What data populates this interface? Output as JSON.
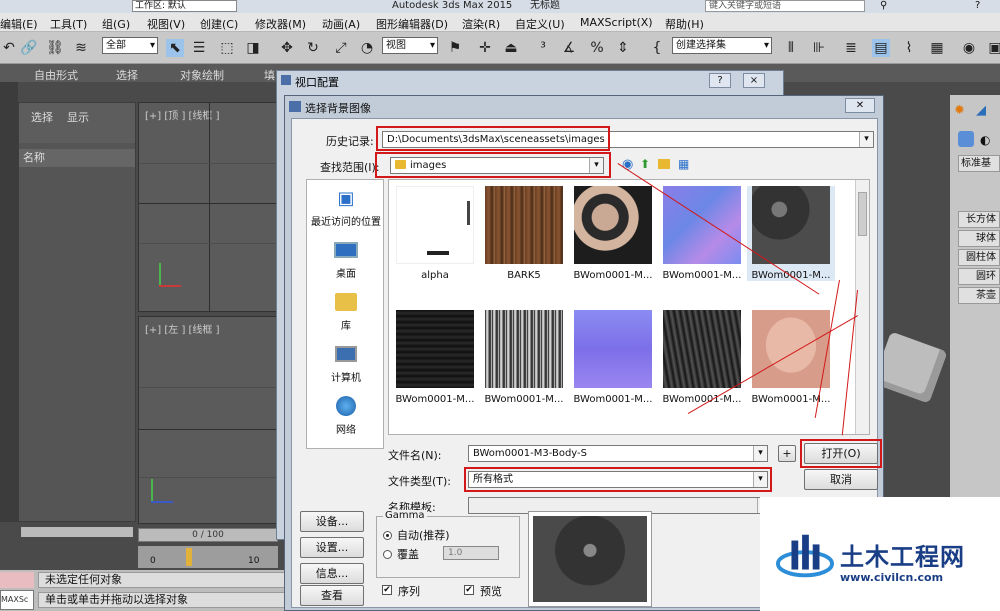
{
  "app": {
    "title": "Autodesk 3ds Max  2015",
    "doc_title": "无标题",
    "workspace": "工作区: 默认",
    "search_placeholder": "键入关键字或短语"
  },
  "menu": [
    "编辑(E)",
    "工具(T)",
    "组(G)",
    "视图(V)",
    "创建(C)",
    "修改器(M)",
    "动画(A)",
    "图形编辑器(D)",
    "渲染(R)",
    "自定义(U)",
    "MAXScript(X)",
    "帮助(H)"
  ],
  "toolbar": {
    "filter": "全部",
    "ref_coord": "视图",
    "named_sel": "创建选择集"
  },
  "ribbon_tabs": [
    "自由形式",
    "选择",
    "对象绘制",
    "填"
  ],
  "left_panel": {
    "tab_select": "选择",
    "tab_display": "显示",
    "name_header": "名称"
  },
  "viewports": {
    "top_label": "[+] [顶 ] [线框 ]",
    "left_label": "[+] [左 ] [线框 ]"
  },
  "right_panel": {
    "dropdown": "标准基本",
    "buttons": [
      "长方体",
      "球体",
      "圆柱体",
      "圆环",
      "茶壶"
    ]
  },
  "timeline": {
    "frame": "0 / 100",
    "tick": "10",
    "tick0": "0"
  },
  "status": {
    "line1": "未选定任何对象",
    "line2": "单击或单击并拖动以选择对象",
    "maxscript": "MAXSc"
  },
  "vpconfig": {
    "title": "视口配置",
    "help": "?",
    "close": "×"
  },
  "dialog": {
    "title": "选择背景图像",
    "close": "✕",
    "history_label": "历史记录:",
    "history_value": "D:\\Documents\\3dsMax\\sceneassets\\images",
    "lookin_label": "查找范围(I):",
    "lookin_value": "images",
    "places": [
      "最近访问的位置",
      "桌面",
      "库",
      "计算机",
      "网络"
    ],
    "files": [
      {
        "name": "alpha"
      },
      {
        "name": "BARK5"
      },
      {
        "name": "BWom0001-M..."
      },
      {
        "name": "BWom0001-M..."
      },
      {
        "name": "BWom0001-M..."
      },
      {
        "name": "BWom0001-M..."
      },
      {
        "name": "BWom0001-M..."
      },
      {
        "name": "BWom0001-M..."
      },
      {
        "name": "BWom0001-M..."
      },
      {
        "name": "BWom0001-M..."
      }
    ],
    "filename_label": "文件名(N):",
    "filename_value": "BWom0001-M3-Body-S",
    "filetype_label": "文件类型(T):",
    "filetype_value": "所有格式",
    "template_label": "名称模板:",
    "plus": "+",
    "open": "打开(O)",
    "cancel": "取消",
    "setup1": "设备...",
    "setup2": "设置...",
    "info": "信息...",
    "view": "查看",
    "gamma_title": "Gamma",
    "gamma_auto": "自动(推荐)",
    "gamma_override": "覆盖",
    "gamma_value": "1.0",
    "sequence": "序列",
    "preview": "预览"
  },
  "watermark": {
    "brand": "土木工程网",
    "url": "www.civilcn.com"
  },
  "colors": {
    "highlight": "#d21818",
    "accent": "#1a3e86"
  }
}
